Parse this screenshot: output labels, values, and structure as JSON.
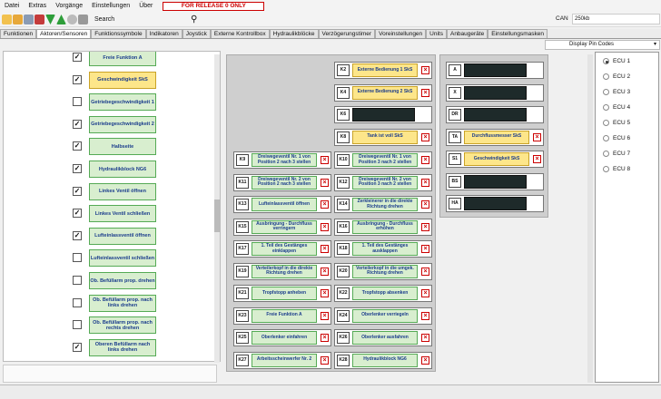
{
  "menubar": {
    "items": [
      "Datei",
      "Extras",
      "Vorgänge",
      "Einstellungen",
      "Über"
    ],
    "release": "FOR RELEASE 0 ONLY"
  },
  "toolbar": {
    "search_label": "Search",
    "can_label": "CAN",
    "can_value": "250kb"
  },
  "tabs": [
    "Funktionen",
    "Aktoren/Sensoren",
    "Funktionssymbole",
    "Indikatoren",
    "Joystick",
    "Externe Kontrollbox",
    "Hydraulikblöcke",
    "Verzögerungstimer",
    "Voreinstellungen",
    "Units",
    "Anbaugeräte",
    "Einstellungsmasken"
  ],
  "active_tab": "Aktoren/Sensoren",
  "display_pin_codes": "Display Pin Codes",
  "left_items": [
    {
      "label": "Freie Funktion A",
      "checked": true,
      "color": "green"
    },
    {
      "label": "Geschwindigkeit SkS",
      "checked": true,
      "color": "yellow"
    },
    {
      "label": "Getriebegeschwindigkeit 1",
      "checked": false,
      "color": "green"
    },
    {
      "label": "Getriebegeschwindigkeit 2",
      "checked": true,
      "color": "green"
    },
    {
      "label": "Halbseite",
      "checked": true,
      "color": "green"
    },
    {
      "label": "Hydraulikblock NG6",
      "checked": true,
      "color": "green"
    },
    {
      "label": "Linkes Ventil öffnen",
      "checked": true,
      "color": "green"
    },
    {
      "label": "Linkes Ventil schließen",
      "checked": true,
      "color": "green"
    },
    {
      "label": "Lufteinlassventil öffnen",
      "checked": true,
      "color": "green"
    },
    {
      "label": "Lufteinlassventil schließen",
      "checked": false,
      "color": "green"
    },
    {
      "label": "Ob. Befüllarm prop. drehen",
      "checked": false,
      "color": "green"
    },
    {
      "label": "Ob. Befüllarm prop. nach links drehen",
      "checked": false,
      "color": "green"
    },
    {
      "label": "Ob. Befüllarm prop. nach rechts drehen",
      "checked": false,
      "color": "green"
    },
    {
      "label": "Oberen Befüllarm nach links drehen",
      "checked": true,
      "color": "green"
    }
  ],
  "center_right_col": [
    {
      "id": "K2",
      "label": "Externe Bedienung 1 SkS",
      "color": "yellow"
    },
    {
      "id": "K4",
      "label": "Externe Bedienung 2 SkS",
      "color": "yellow"
    },
    {
      "id": "K6",
      "label": "",
      "color": "dark"
    },
    {
      "id": "K8",
      "label": "Tank ist voll SkS",
      "color": "yellow"
    }
  ],
  "center_pairs": [
    [
      {
        "id": "K9",
        "label": "Dreiwegeventil Nr. 1 von Position 2 nach 3 stellen"
      },
      {
        "id": "K10",
        "label": "Dreiwegeventil Nr. 1 von Position 3 nach 2 stellen"
      }
    ],
    [
      {
        "id": "K11",
        "label": "Dreiwegeventil Nr. 2 von Position 2 nach 3 stellen"
      },
      {
        "id": "K12",
        "label": "Dreiwegeventil Nr. 2 von Position 3 nach 2 stellen"
      }
    ],
    [
      {
        "id": "K13",
        "label": "Lufteinlassventil öffnen"
      },
      {
        "id": "K14",
        "label": "Zerkleinerer in die direkte Richtung drehen"
      }
    ],
    [
      {
        "id": "K15",
        "label": "Ausbringung - Durchfluss verringern"
      },
      {
        "id": "K16",
        "label": "Ausbringung - Durchfluss erhöhen"
      }
    ],
    [
      {
        "id": "K17",
        "label": "1. Teil des Gestänges einklappen"
      },
      {
        "id": "K18",
        "label": "1. Teil des Gestänges ausklappen"
      }
    ],
    [
      {
        "id": "K19",
        "label": "Verteilerkopf in die direkte Richtung drehen"
      },
      {
        "id": "K20",
        "label": "Verteilerkopf in die umgek. Richtung drehen"
      }
    ],
    [
      {
        "id": "K21",
        "label": "Tropfstopp anheben"
      },
      {
        "id": "K22",
        "label": "Tropfstopp absenken"
      }
    ],
    [
      {
        "id": "K23",
        "label": "Freie Funktion A"
      },
      {
        "id": "K24",
        "label": "Oberlenker verriegeln"
      }
    ],
    [
      {
        "id": "K25",
        "label": "Oberlenker einfahren"
      },
      {
        "id": "K26",
        "label": "Oberlenker ausfahren"
      }
    ],
    [
      {
        "id": "K27",
        "label": "Arbeitsscheinwerfer Nr. 2"
      },
      {
        "id": "K28",
        "label": "Hydraulikblock NG6"
      }
    ]
  ],
  "right_items": [
    {
      "id": "A",
      "label": "",
      "color": "dark"
    },
    {
      "id": "X",
      "label": "",
      "color": "dark"
    },
    {
      "id": "DR",
      "label": "",
      "color": "dark"
    },
    {
      "id": "TA",
      "label": "Durchflussmesser SkS",
      "color": "yellow"
    },
    {
      "id": "S1",
      "label": "Geschwindigkeit SkS",
      "color": "yellow"
    },
    {
      "id": "BS",
      "label": "",
      "color": "dark"
    },
    {
      "id": "HA",
      "label": "",
      "color": "dark"
    }
  ],
  "ecus": [
    "ECU 1",
    "ECU 2",
    "ECU 3",
    "ECU 4",
    "ECU 5",
    "ECU 6",
    "ECU 7",
    "ECU 8"
  ],
  "ecu_selected": 0
}
